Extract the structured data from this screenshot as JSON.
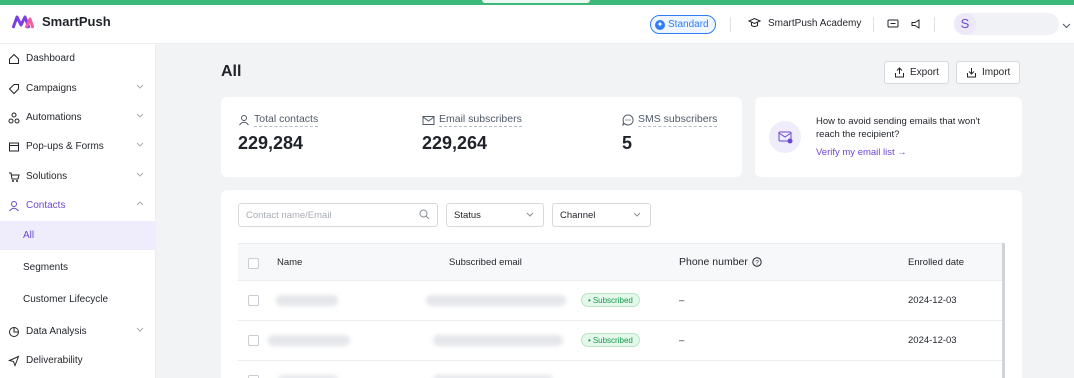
{
  "app": {
    "name": "SmartPush",
    "plan": "Standard",
    "academy": "SmartPush Academy",
    "user_initial": "S"
  },
  "colors": {
    "accent": "#6b47d6",
    "plan_blue": "#2f7cf6",
    "success": "#1a9a4b",
    "top_stripe": "#3cb878"
  },
  "sidebar": {
    "items": [
      {
        "label": "Dashboard",
        "icon": "home-icon"
      },
      {
        "label": "Campaigns",
        "icon": "tag-icon"
      },
      {
        "label": "Automations",
        "icon": "automation-icon"
      },
      {
        "label": "Pop-ups & Forms",
        "icon": "popup-icon"
      },
      {
        "label": "Solutions",
        "icon": "cart-icon"
      },
      {
        "label": "Contacts",
        "icon": "user-icon"
      },
      {
        "label": "Data Analysis",
        "icon": "pie-icon"
      },
      {
        "label": "Deliverability",
        "icon": "send-icon"
      }
    ],
    "contacts_sub": [
      "All",
      "Segments",
      "Customer Lifecycle"
    ]
  },
  "page": {
    "title": "All",
    "export_label": "Export",
    "import_label": "Import"
  },
  "stats": [
    {
      "label": "Total contacts",
      "value": "229,284",
      "icon": "person-icon"
    },
    {
      "label": "Email subscribers",
      "value": "229,264",
      "icon": "mail-icon"
    },
    {
      "label": "SMS subscribers",
      "value": "5",
      "icon": "chat-icon"
    }
  ],
  "tip": {
    "text": "How to avoid sending emails that won't reach the recipient?",
    "link": "Verify my email list →"
  },
  "filters": {
    "search_placeholder": "Contact name/Email",
    "status_label": "Status",
    "channel_label": "Channel"
  },
  "table": {
    "columns": [
      "Name",
      "Subscribed email",
      "Phone number",
      "Enrolled date"
    ],
    "rows": [
      {
        "status": "Subscribed",
        "phone": "–",
        "date": "2024-12-03"
      },
      {
        "status": "Subscribed",
        "phone": "–",
        "date": "2024-12-03"
      }
    ]
  }
}
